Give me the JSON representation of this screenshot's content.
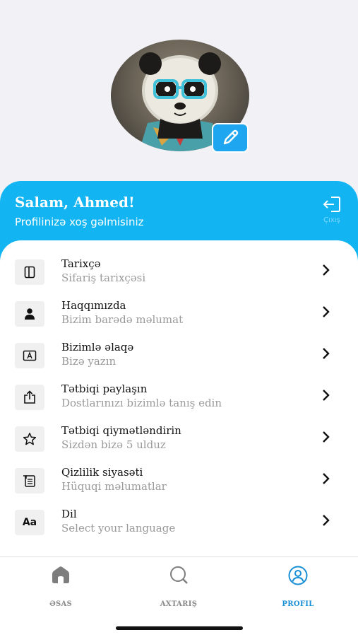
{
  "profile": {
    "avatar_alt": "panda-avatar",
    "greeting": "Salam, Ahmed!",
    "welcome": "Profilinizə xoş gəlmisiniz",
    "logout_label": "Çıxış"
  },
  "menu": [
    {
      "icon": "sidebar-icon",
      "title": "Tarixçə",
      "subtitle": "Sifariş tarixçəsi"
    },
    {
      "icon": "person-icon",
      "title": "Haqqımızda",
      "subtitle": "Bizim barədə məlumat"
    },
    {
      "icon": "contact-card-icon",
      "title": "Bizimlə əlaqə",
      "subtitle": "Bizə yazın"
    },
    {
      "icon": "share-icon",
      "title": "Tətbiqi paylaşın",
      "subtitle": "Dostlarınızı bizimlə tanış edin"
    },
    {
      "icon": "star-icon",
      "title": "Tətbiqi qiymətləndirin",
      "subtitle": "Sizdən bizə 5 ulduz"
    },
    {
      "icon": "privacy-doc-icon",
      "title": "Qizlilik siyasəti",
      "subtitle": "Hüquqi məlumatlar"
    },
    {
      "icon": "language-icon",
      "title": "Dil",
      "subtitle": "Select your language",
      "icon_text": "Aa"
    }
  ],
  "tabs": [
    {
      "label": "ƏSAS",
      "icon": "home-icon",
      "active": false
    },
    {
      "label": "AXTARIŞ",
      "icon": "search-icon",
      "active": false
    },
    {
      "label": "PROFIL",
      "icon": "profile-icon",
      "active": true
    }
  ],
  "colors": {
    "accent": "#12b4f2",
    "active_tab": "#1a8fd6",
    "background": "#f2f1f6"
  }
}
